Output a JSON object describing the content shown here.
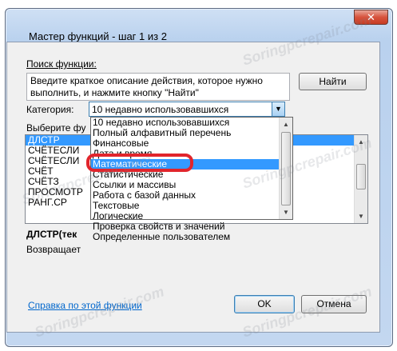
{
  "window": {
    "title": "Мастер функций - шаг 1 из 2",
    "close_glyph": "✕"
  },
  "search": {
    "label": "Поиск функции:",
    "text": "Введите краткое описание действия, которое нужно выполнить, и нажмите кнопку \"Найти\"",
    "find_button": "Найти"
  },
  "category": {
    "label": "Категория:",
    "selected": "10 недавно использовавшихся",
    "options": [
      "10 недавно использовавшихся",
      "Полный алфавитный перечень",
      "Финансовые",
      "Дата и время",
      "Математические",
      "Статистические",
      "Ссылки и массивы",
      "Работа с базой данных",
      "Текстовые",
      "Логические",
      "Проверка свойств и значений",
      "Определенные пользователем"
    ],
    "highlighted_index": 4
  },
  "function_list": {
    "label": "Выберите фу",
    "items": [
      "ДЛСТР",
      "СЧЁТЕСЛИ",
      "СЧЁТЕСЛИ",
      "СЧЁТ",
      "СЧЁТЗ",
      "ПРОСМОТР",
      "РАНГ.СР"
    ],
    "selected_index": 0
  },
  "signature": "ДЛСТР(тек",
  "description": "Возвращает",
  "help_link": "Справка по этой функции",
  "buttons": {
    "ok": "OK",
    "cancel": "Отмена"
  },
  "watermark": "Soringpcrepair.com",
  "colors": {
    "selection": "#3399ff",
    "highlight_ring": "#e1252c",
    "link": "#0066cc"
  }
}
